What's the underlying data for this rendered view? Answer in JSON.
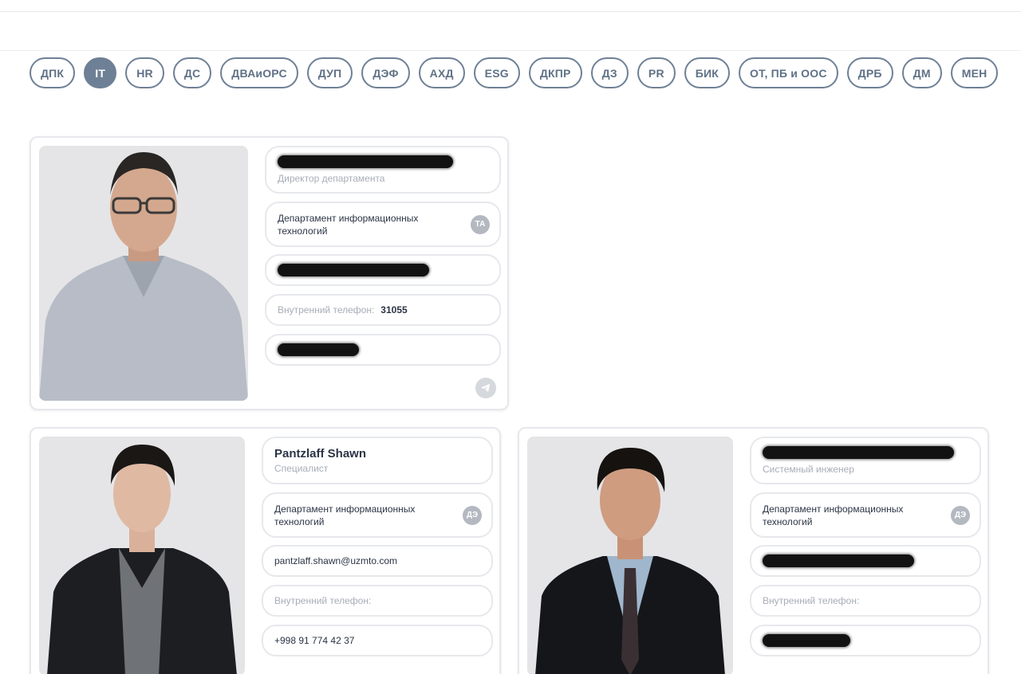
{
  "tabs": [
    {
      "label": "ДПК",
      "active": false
    },
    {
      "label": "IT",
      "active": true
    },
    {
      "label": "HR",
      "active": false
    },
    {
      "label": "ДС",
      "active": false
    },
    {
      "label": "ДВАиОРС",
      "active": false
    },
    {
      "label": "ДУП",
      "active": false
    },
    {
      "label": "ДЭФ",
      "active": false
    },
    {
      "label": "АХД",
      "active": false
    },
    {
      "label": "ESG",
      "active": false
    },
    {
      "label": "ДКПР",
      "active": false
    },
    {
      "label": "ДЗ",
      "active": false
    },
    {
      "label": "PR",
      "active": false
    },
    {
      "label": "БИК",
      "active": false
    },
    {
      "label": "ОТ, ПБ и ООС",
      "active": false
    },
    {
      "label": "ДРБ",
      "active": false
    },
    {
      "label": "ДМ",
      "active": false
    },
    {
      "label": "МЕН",
      "active": false
    }
  ],
  "cards": [
    {
      "name": "",
      "name_redacted": true,
      "position": "Директор департамента",
      "department": "Департамент информационных технологий",
      "badge": "ТА",
      "email": "",
      "email_redacted": true,
      "phone_label": "Внутренний телефон:",
      "phone_value": "31055",
      "mobile": "",
      "mobile_redacted": true,
      "telegram_icon": "telegram-icon"
    },
    {
      "name": "Pantzlaff Shawn",
      "name_redacted": false,
      "position": "Специалист",
      "department": "Департамент информационных технологий",
      "badge": "ДЭ",
      "email": "pantzlaff.shawn@uzmto.com",
      "email_redacted": false,
      "phone_label": "Внутренний телефон:",
      "phone_value": "",
      "mobile": "+998 91 774 42 37",
      "mobile_redacted": false
    },
    {
      "name": "",
      "name_redacted": true,
      "position": "Системный инженер",
      "department": "Департамент информационных технологий",
      "badge": "ДЭ",
      "email": "",
      "email_redacted": true,
      "phone_label": "Внутренний телефон:",
      "phone_value": "",
      "mobile": "",
      "mobile_redacted": true
    }
  ],
  "colors": {
    "accent": "#6e8095",
    "border": "#e6e8ec",
    "muted_text": "#a7adb7",
    "badge": "#b3b8c1"
  }
}
